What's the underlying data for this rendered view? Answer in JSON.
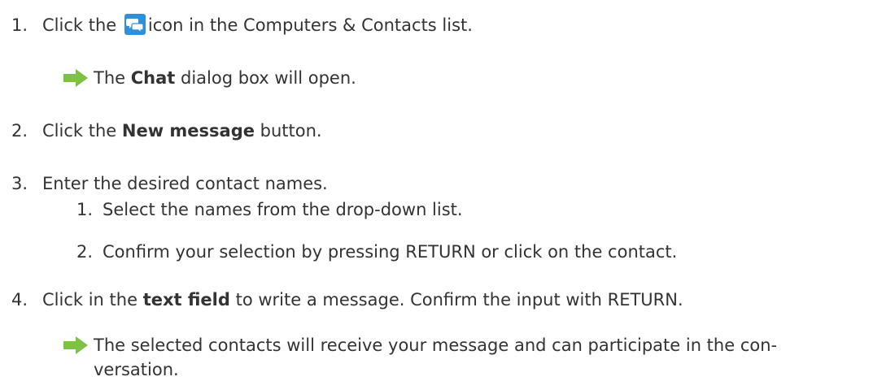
{
  "steps": [
    {
      "number": "1.",
      "text_before_icon": "Click the",
      "icon": "chat-icon",
      "text_after_icon": "icon in the Computers & Contacts list.",
      "result": {
        "before": "The",
        "bold": "Chat",
        "after": "dialog box will open."
      }
    },
    {
      "number": "2.",
      "before": "Click the",
      "bold": "New message",
      "after": "button."
    },
    {
      "number": "3.",
      "text": "Enter the desired contact names.",
      "substeps": [
        {
          "number": "1.",
          "text": "Select the names from the drop-down list."
        },
        {
          "number": "2.",
          "text": "Confirm your selection by pressing RETURN or click on the contact."
        }
      ]
    },
    {
      "number": "4.",
      "before": "Click in the",
      "bold": "text field",
      "after": "to write a message. Confirm the input with RETURN.",
      "result": {
        "line1": "The selected contacts will receive your message and can participate in the con-",
        "line2": "versation."
      }
    }
  ],
  "colors": {
    "text": "#333333",
    "arrow": "#7dc242",
    "icon_bg": "#2f8fd8"
  }
}
